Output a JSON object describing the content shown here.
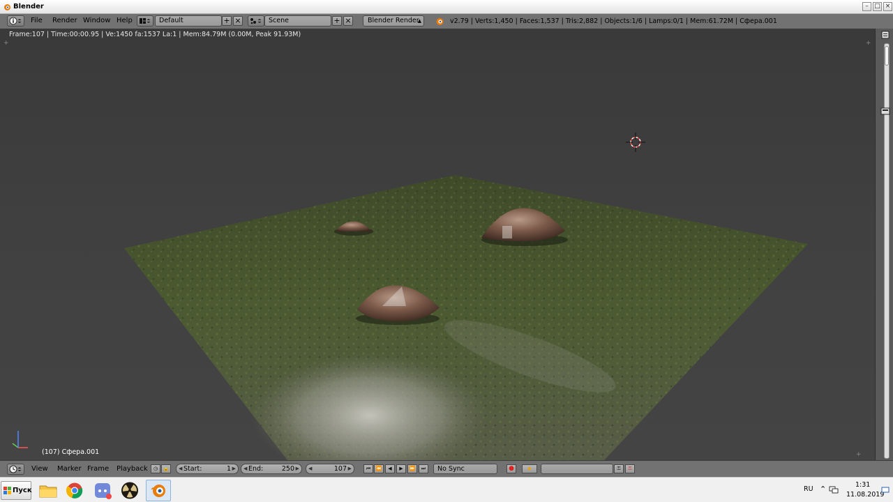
{
  "window": {
    "title": "Blender",
    "min_label": "–",
    "max_label": "□",
    "close_label": "×"
  },
  "header": {
    "menus": [
      "File",
      "Render",
      "Window",
      "Help"
    ],
    "screen_layout": "Default",
    "scene": "Scene",
    "engine": "Blender Render",
    "stats": "v2.79 | Verts:1,450 | Faces:1,537 | Tris:2,882 | Objects:1/6 | Lamps:0/1 | Mem:61.72M | Сфера.001",
    "add_label": "+",
    "remove_label": "×"
  },
  "viewport": {
    "info": "Frame:107 | Time:00:00.95 | Ve:1450 fa:1537 La:1 | Mem:84.79M (0.00M, Peak 91.93M)",
    "active_object": "(107) Сфера.001",
    "corner_label": "+"
  },
  "timeline": {
    "menus": [
      "View",
      "Marker",
      "Frame",
      "Playback"
    ],
    "start_label": "Start:",
    "start_value": "1",
    "end_label": "End:",
    "end_value": "250",
    "current_frame": "107",
    "sync": "No Sync"
  },
  "taskbar": {
    "start_label": "Пуск",
    "apps": [
      "explorer-icon",
      "chrome-icon",
      "discord-icon",
      "radiation-icon",
      "blender-icon"
    ],
    "lang": "RU",
    "time": "1:31",
    "date": "11.08.2019"
  },
  "colors": {
    "header_bg": "#727272",
    "viewport_bg": "#3d3d3d",
    "grass": "#4a5a2c",
    "path": "#b9b9b0",
    "stone": "#7a5a4a",
    "blender_orange": "#e87d0d"
  }
}
